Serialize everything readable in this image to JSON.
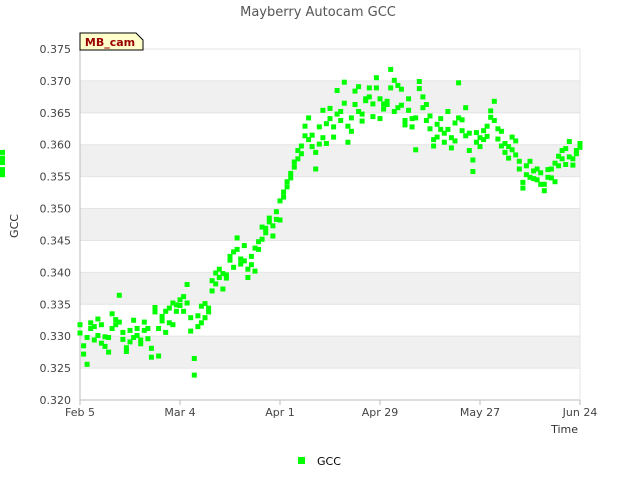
{
  "chart_data": {
    "type": "scatter",
    "title": "Mayberry Autocam GCC",
    "xlabel": "Time",
    "ylabel": "GCC",
    "annotation": "MB_cam",
    "x_tick_labels": [
      "Feb 5",
      "Mar 4",
      "Apr 1",
      "Apr 29",
      "May 27",
      "Jun 24"
    ],
    "x_tick_days": [
      0,
      28,
      56,
      84,
      112,
      140
    ],
    "x_range_days": [
      0,
      140
    ],
    "ylim": [
      0.32,
      0.375
    ],
    "y_ticks": [
      0.32,
      0.325,
      0.33,
      0.335,
      0.34,
      0.345,
      0.35,
      0.355,
      0.36,
      0.365,
      0.37,
      0.375
    ],
    "grid": "alternating horizontal bands",
    "legend_position": "bottom-center",
    "series": [
      {
        "name": "GCC",
        "color": "#00ff00",
        "marker": "square",
        "x_days": [
          0,
          0,
          1,
          1,
          2,
          2,
          3,
          3,
          4,
          4,
          5,
          5,
          6,
          6,
          7,
          7,
          8,
          8,
          9,
          9,
          10,
          10,
          11,
          11,
          12,
          12,
          13,
          13,
          14,
          14,
          15,
          15,
          16,
          16,
          17,
          17,
          18,
          18,
          19,
          19,
          20,
          20,
          21,
          21,
          22,
          22,
          23,
          23,
          24,
          24,
          25,
          25,
          26,
          26,
          27,
          27,
          28,
          28,
          29,
          29,
          30,
          30,
          31,
          31,
          32,
          32,
          33,
          33,
          34,
          34,
          35,
          35,
          36,
          36,
          37,
          37,
          38,
          38,
          39,
          39,
          40,
          40,
          41,
          41,
          42,
          42,
          43,
          43,
          44,
          44,
          45,
          45,
          46,
          46,
          47,
          47,
          48,
          48,
          49,
          49,
          50,
          50,
          51,
          51,
          52,
          52,
          53,
          53,
          54,
          54,
          55,
          55,
          56,
          56,
          57,
          57,
          58,
          58,
          59,
          59,
          60,
          60,
          61,
          61,
          62,
          62,
          63,
          63,
          64,
          64,
          65,
          65,
          66,
          66,
          67,
          67,
          68,
          68,
          69,
          69,
          70,
          70,
          71,
          71,
          72,
          72,
          73,
          73,
          74,
          74,
          75,
          75,
          76,
          76,
          77,
          77,
          78,
          78,
          79,
          79,
          80,
          80,
          81,
          81,
          82,
          82,
          83,
          83,
          84,
          84,
          85,
          85,
          86,
          86,
          87,
          87,
          88,
          88,
          89,
          89,
          90,
          90,
          91,
          91,
          92,
          92,
          93,
          93,
          94,
          94,
          95,
          95,
          96,
          96,
          97,
          97,
          98,
          98,
          99,
          99,
          100,
          100,
          101,
          101,
          102,
          102,
          103,
          103,
          104,
          104,
          105,
          105,
          106,
          106,
          107,
          107,
          108,
          108,
          109,
          109,
          110,
          110,
          111,
          111,
          112,
          112,
          113,
          113,
          114,
          114,
          115,
          115,
          116,
          116,
          117,
          117,
          118,
          118,
          119,
          119,
          120,
          120,
          121,
          121,
          122,
          122,
          123,
          123,
          124,
          124,
          125,
          125,
          126,
          126,
          127,
          127,
          128,
          128,
          129,
          129,
          130,
          130,
          131,
          131,
          132,
          132,
          133,
          133,
          134,
          134,
          135,
          135,
          136,
          136,
          137,
          137,
          138,
          138,
          139,
          139,
          140,
          140
        ],
        "values": [
          0.3318,
          0.3305,
          0.3272,
          0.3285,
          0.3256,
          0.3298,
          0.3312,
          0.3321,
          0.3294,
          0.3315,
          0.3327,
          0.3301,
          0.3289,
          0.3318,
          0.3299,
          0.3284,
          0.3275,
          0.3298,
          0.3312,
          0.3335,
          0.3326,
          0.3318,
          0.3322,
          0.3364,
          0.3306,
          0.3295,
          0.3282,
          0.3276,
          0.3291,
          0.3309,
          0.3298,
          0.3325,
          0.3312,
          0.3301,
          0.3288,
          0.3294,
          0.3322,
          0.3309,
          0.3296,
          0.3312,
          0.3281,
          0.3267,
          0.3345,
          0.3338,
          0.3312,
          0.3269,
          0.3324,
          0.3331,
          0.3306,
          0.3339,
          0.3344,
          0.3321,
          0.3318,
          0.3352,
          0.3339,
          0.3349,
          0.3357,
          0.3348,
          0.3362,
          0.3339,
          0.3352,
          0.3381,
          0.3329,
          0.3308,
          0.3239,
          0.3265,
          0.3315,
          0.3332,
          0.3347,
          0.3321,
          0.3351,
          0.3329,
          0.3338,
          0.3344,
          0.3371,
          0.3387,
          0.3399,
          0.3382,
          0.3392,
          0.3405,
          0.3374,
          0.3398,
          0.3396,
          0.3391,
          0.3419,
          0.3425,
          0.3432,
          0.3408,
          0.3454,
          0.3436,
          0.3421,
          0.3413,
          0.3418,
          0.3442,
          0.3405,
          0.3392,
          0.3412,
          0.3425,
          0.3402,
          0.3438,
          0.3436,
          0.3448,
          0.3471,
          0.3452,
          0.3462,
          0.3469,
          0.3485,
          0.3479,
          0.3457,
          0.3473,
          0.3483,
          0.3495,
          0.3482,
          0.3512,
          0.3518,
          0.3526,
          0.3534,
          0.3542,
          0.3555,
          0.3548,
          0.3565,
          0.3573,
          0.3578,
          0.3591,
          0.3586,
          0.3598,
          0.3614,
          0.3629,
          0.3642,
          0.3608,
          0.3597,
          0.3615,
          0.3588,
          0.3562,
          0.3601,
          0.3628,
          0.3654,
          0.3611,
          0.3602,
          0.3633,
          0.3641,
          0.3657,
          0.3612,
          0.3628,
          0.3648,
          0.3685,
          0.3638,
          0.3652,
          0.3665,
          0.3698,
          0.3629,
          0.3604,
          0.3642,
          0.3621,
          0.3663,
          0.3684,
          0.3691,
          0.3652,
          0.3648,
          0.3637,
          0.3669,
          0.3672,
          0.3689,
          0.3675,
          0.3644,
          0.3664,
          0.3689,
          0.3705,
          0.3672,
          0.3641,
          0.3656,
          0.3664,
          0.3663,
          0.3668,
          0.3689,
          0.3718,
          0.3701,
          0.3652,
          0.3658,
          0.3693,
          0.3687,
          0.3662,
          0.3638,
          0.3631,
          0.3672,
          0.3654,
          0.3641,
          0.3628,
          0.3642,
          0.3592,
          0.3688,
          0.3699,
          0.3675,
          0.3658,
          0.3663,
          0.3638,
          0.3625,
          0.3645,
          0.3608,
          0.3598,
          0.3612,
          0.3632,
          0.3641,
          0.3624,
          0.3618,
          0.3604,
          0.3652,
          0.3624,
          0.3611,
          0.3595,
          0.3606,
          0.3634,
          0.3642,
          0.3697,
          0.3622,
          0.3639,
          0.3658,
          0.3614,
          0.3618,
          0.3591,
          0.3558,
          0.3576,
          0.3619,
          0.3604,
          0.3611,
          0.3597,
          0.3608,
          0.3622,
          0.3613,
          0.3629,
          0.3643,
          0.3653,
          0.3638,
          0.3668,
          0.3609,
          0.3625,
          0.3598,
          0.3621,
          0.3602,
          0.3588,
          0.3579,
          0.3597,
          0.3612,
          0.3592,
          0.3584,
          0.3606,
          0.3574,
          0.3562,
          0.3532,
          0.3541,
          0.3567,
          0.3553,
          0.3549,
          0.3574,
          0.3559,
          0.3547,
          0.3562,
          0.3545,
          0.3538,
          0.3556,
          0.3528,
          0.3538,
          0.3549,
          0.3561,
          0.3562,
          0.3548,
          0.3571,
          0.3542,
          0.3567,
          0.3582,
          0.3591,
          0.3578,
          0.3569,
          0.3594,
          0.3605,
          0.3581,
          0.3568,
          0.3578,
          0.3586,
          0.3591,
          0.3596,
          0.3602,
          0.3579,
          0.3588,
          0.3572,
          0.3553,
          0.3561,
          0.3554
        ]
      }
    ]
  }
}
